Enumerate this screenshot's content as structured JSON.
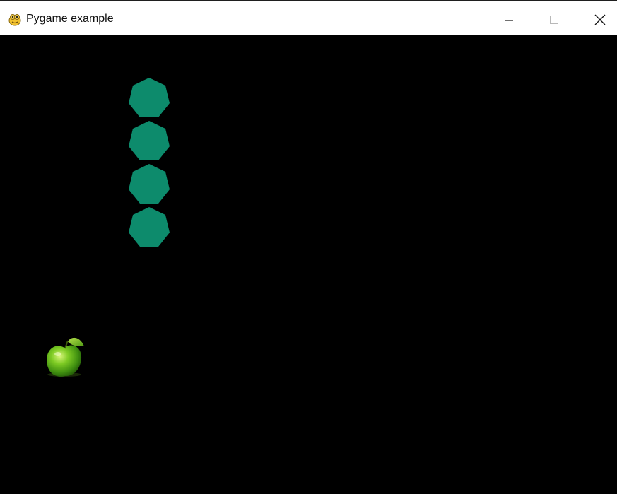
{
  "window": {
    "title": "Pygame example",
    "app_icon": "pygame-snake-icon",
    "controls": [
      "minimize-icon",
      "maximize-icon",
      "close-icon"
    ]
  },
  "game": {
    "background_color": "#000000",
    "snake": {
      "color": "#0d8b6c",
      "segment_shape": "heptagon",
      "segment_count": 4
    },
    "food": {
      "type": "green-apple",
      "color": "#5fbf1a"
    }
  }
}
